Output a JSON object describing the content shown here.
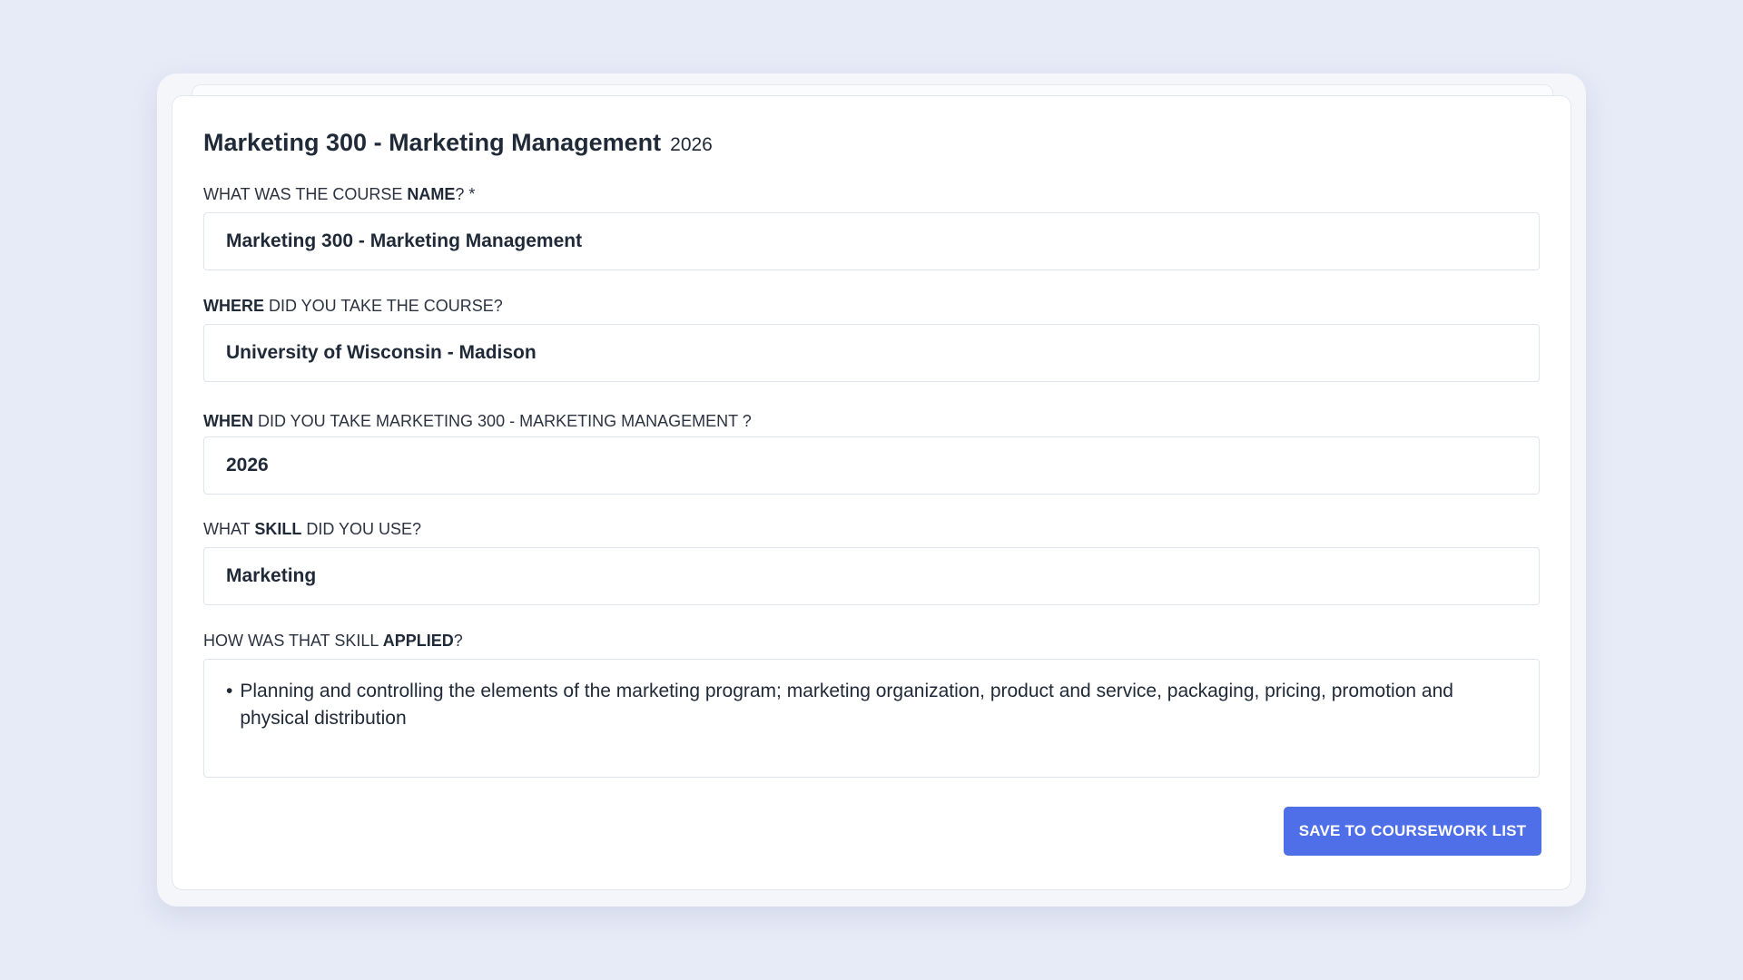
{
  "header": {
    "title": "Marketing 300 - Marketing Management",
    "year": "2026"
  },
  "fields": {
    "course_name": {
      "label_pre": "What was the course ",
      "label_bold": "Name",
      "label_post": "? *",
      "value": "Marketing 300 - Marketing Management"
    },
    "where": {
      "label_bold": "Where",
      "label_post": " did you take the course?",
      "value": "University of Wisconsin - Madison"
    },
    "when": {
      "label_bold": "When",
      "label_post": " did you take Marketing 300 - Marketing Management ?",
      "value": "2026"
    },
    "skill": {
      "label_pre": "What ",
      "label_bold": "Skill",
      "label_post": " did you use?",
      "value": "Marketing"
    },
    "applied": {
      "label_pre": "How was that skill ",
      "label_bold": "Applied",
      "label_post": "?",
      "bullet": "•",
      "value": "Planning and controlling the elements of the marketing program; marketing organization, product and service, packaging, pricing, promotion and physical distribution"
    }
  },
  "actions": {
    "save_label": "Save to coursework list"
  },
  "colors": {
    "background": "#e7ebf7",
    "accent": "#4e6fe8",
    "input_border": "#dfe3ea"
  }
}
